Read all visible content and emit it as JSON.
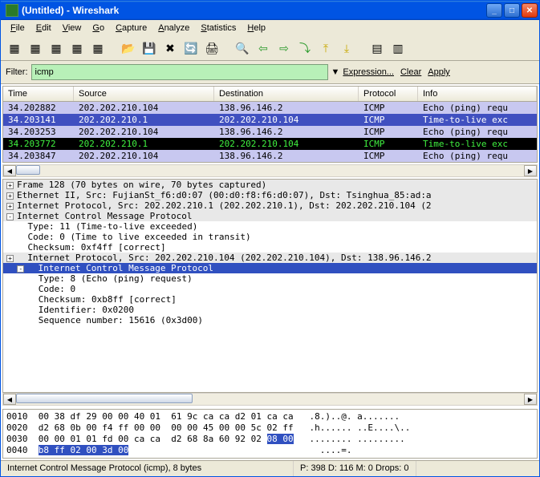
{
  "window": {
    "title": "(Untitled) - Wireshark"
  },
  "menu": {
    "file": "File",
    "edit": "Edit",
    "view": "View",
    "go": "Go",
    "capture": "Capture",
    "analyze": "Analyze",
    "statistics": "Statistics",
    "help": "Help"
  },
  "filter": {
    "label": "Filter:",
    "value": "icmp",
    "dropdown": "▼",
    "expression": "Expression...",
    "clear": "Clear",
    "apply": "Apply"
  },
  "columns": {
    "time": "Time",
    "source": "Source",
    "destination": "Destination",
    "protocol": "Protocol",
    "info": "Info"
  },
  "packets": [
    {
      "time": "34.202882",
      "src": "202.202.210.104",
      "dst": "138.96.146.2",
      "proto": "ICMP",
      "info": "Echo (ping) requ",
      "cls": "row-purple"
    },
    {
      "time": "34.203141",
      "src": "202.202.210.1",
      "dst": "202.202.210.104",
      "proto": "ICMP",
      "info": "Time-to-live exc",
      "cls": "row-blue-sel"
    },
    {
      "time": "34.203253",
      "src": "202.202.210.104",
      "dst": "138.96.146.2",
      "proto": "ICMP",
      "info": "Echo (ping) requ",
      "cls": "row-purple"
    },
    {
      "time": "34.203772",
      "src": "202.202.210.1",
      "dst": "202.202.210.104",
      "proto": "ICMP",
      "info": "Time-to-live exc",
      "cls": "row-black"
    },
    {
      "time": "34.203847",
      "src": "202.202.210.104",
      "dst": "138.96.146.2",
      "proto": "ICMP",
      "info": "Echo (ping) requ",
      "cls": "row-purple"
    }
  ],
  "detail": {
    "l1": "Frame 128 (70 bytes on wire, 70 bytes captured)",
    "l2": "Ethernet II, Src: FujianSt_f6:d0:07 (00:d0:f8:f6:d0:07), Dst: Tsinghua_85:ad:a",
    "l3": "Internet Protocol, Src: 202.202.210.1 (202.202.210.1), Dst: 202.202.210.104 (2",
    "l4": "Internet Control Message Protocol",
    "l5": "    Type: 11 (Time-to-live exceeded)",
    "l6": "    Code: 0 (Time to live exceeded in transit)",
    "l7": "    Checksum: 0xf4ff [correct]",
    "l8": "  Internet Protocol, Src: 202.202.210.104 (202.202.210.104), Dst: 138.96.146.2",
    "l9": "  Internet Control Message Protocol",
    "l10": "      Type: 8 (Echo (ping) request)",
    "l11": "      Code: 0",
    "l12": "      Checksum: 0xb8ff [correct]",
    "l13": "      Identifier: 0x0200",
    "l14": "      Sequence number: 15616 (0x3d00)"
  },
  "hex": {
    "r1a": "0010  00 38 df 29 00 00 40 01  61 9c ca ca d2 01 ca ca   .8.)..@. a.......",
    "r2a": "0020  d2 68 0b 00 f4 ff 00 00  00 00 45 00 00 5c 02 ff   .h...... ..E....\\..",
    "r3a": "0030  00 00 01 01 fd 00 ca ca  d2 68 8a 60 92 02 ",
    "r3b": "08 00",
    "r3c": "   ........ .........",
    "r4a": "0040  ",
    "r4b": "b8 ff 02 00 3d 00",
    "r4c": "                                    ....=.          "
  },
  "status": {
    "left": "Internet Control Message Protocol (icmp), 8 bytes",
    "right": "P: 398 D: 116 M: 0 Drops: 0"
  },
  "icons": {
    "i1": "📄",
    "i2": "📋",
    "i3": "💾",
    "i4": "🔄",
    "i5": "📁",
    "open": "📂",
    "save": "💾",
    "close": "✖",
    "reload": "🔄",
    "print": "🖨",
    "find": "🔍",
    "back": "◀",
    "fwd": "▶",
    "jump": "⤴",
    "up": "⬆",
    "down": "⬇",
    "colorize": "☰",
    "autoscroll": "☰"
  }
}
